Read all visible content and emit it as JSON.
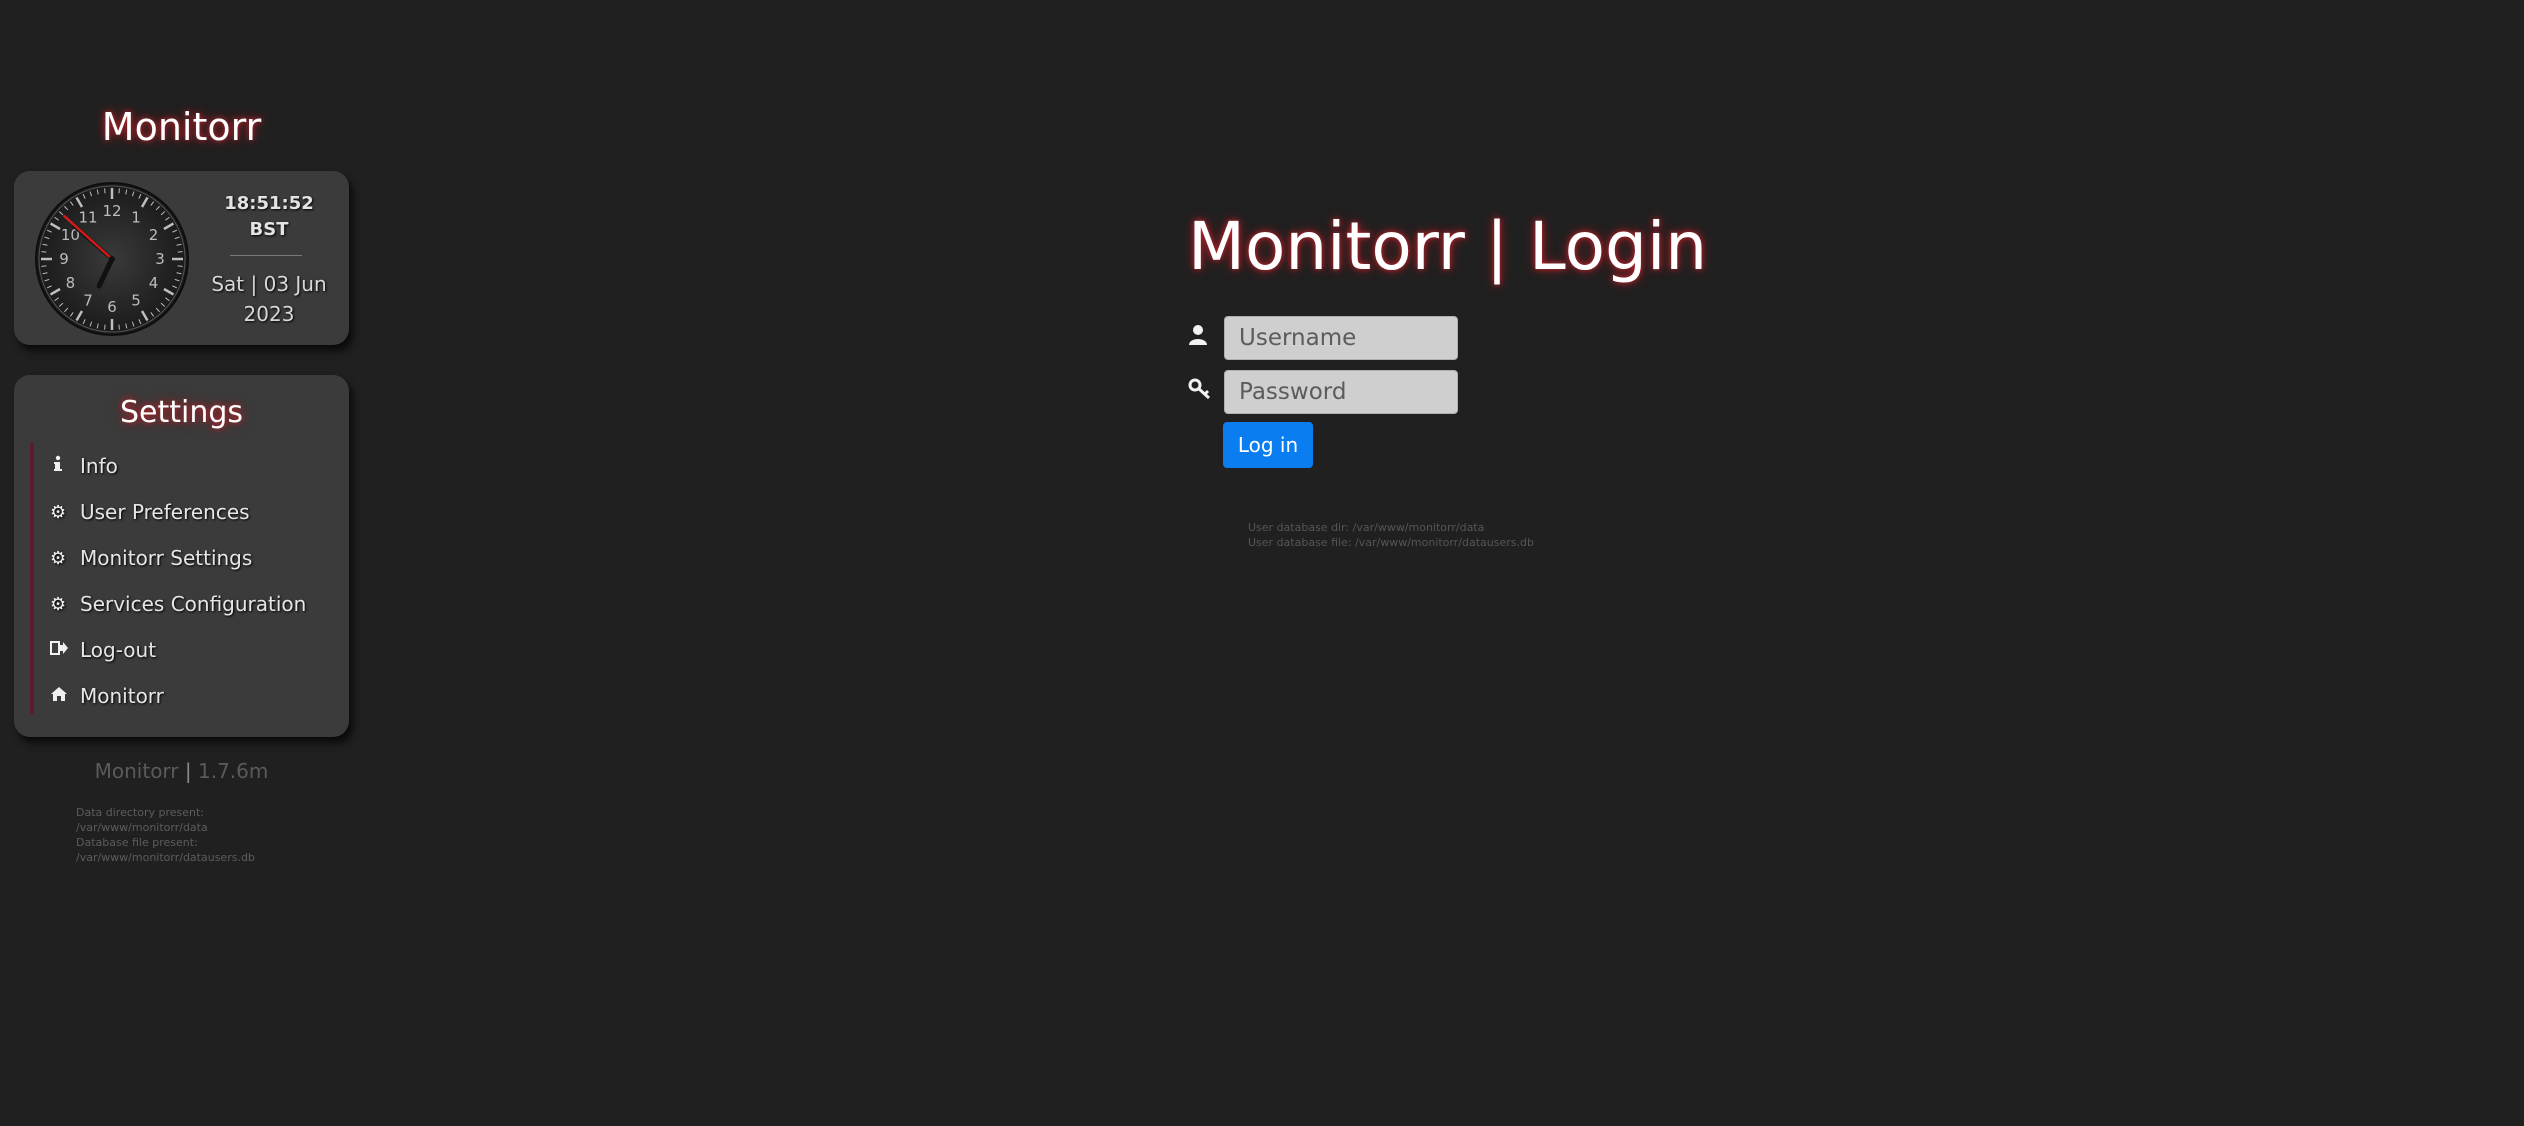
{
  "sidebar": {
    "brand": "Monitorr",
    "clock": {
      "time": "18:51:52",
      "timezone": "BST",
      "date": "Sat | 03 Jun 2023",
      "dial_numbers": [
        "12",
        "1",
        "2",
        "3",
        "4",
        "5",
        "6",
        "7",
        "8",
        "9",
        "10",
        "11"
      ]
    },
    "settings": {
      "title": "Settings",
      "items": [
        {
          "label": "Info",
          "icon": "info-icon"
        },
        {
          "label": "User Preferences",
          "icon": "gear-icon"
        },
        {
          "label": "Monitorr Settings",
          "icon": "gear-icon"
        },
        {
          "label": "Services Configuration",
          "icon": "gear-icon"
        },
        {
          "label": "Log-out",
          "icon": "sign-out-icon"
        },
        {
          "label": "Monitorr",
          "icon": "home-icon"
        }
      ]
    },
    "version": {
      "name": "Monitorr",
      "separator": "|",
      "number": "1.7.6m"
    },
    "data_info": [
      "Data directory present:",
      "/var/www/monitorr/data",
      "Database file present:",
      "/var/www/monitorr/datausers.db"
    ]
  },
  "login": {
    "title": "Monitorr | Login",
    "username": {
      "placeholder": "Username",
      "value": "",
      "icon": "user-icon"
    },
    "password": {
      "placeholder": "Password",
      "value": "",
      "icon": "key-icon"
    },
    "button": "Log in",
    "db_info": [
      "User database dir: /var/www/monitorr/data",
      "User database file: /var/www/monitorr/datausers.db"
    ]
  },
  "colors": {
    "background": "#202020",
    "card": "#3b3b3b",
    "glow": "#c2262e",
    "button": "#0a7df0",
    "menu_accent": "#5e1a2e"
  }
}
